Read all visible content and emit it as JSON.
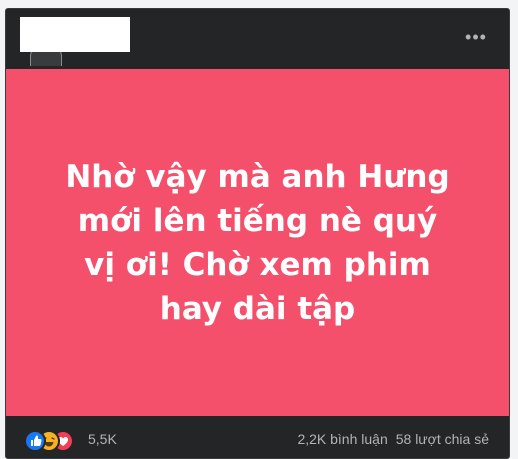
{
  "post": {
    "more_label": "•••",
    "status_text": "Nhờ vậy mà anh Hưng mới lên tiếng nè quý vị ơi! Chờ xem phim hay dài tập"
  },
  "footer": {
    "reaction_icons": [
      "like-icon",
      "haha-icon",
      "love-icon"
    ],
    "reaction_count": "5,5K",
    "comments": "2,2K bình luận",
    "shares": "58 lượt chia sẻ"
  },
  "colors": {
    "background": "#f3f4f6",
    "card": "#242526",
    "status_background": "#f4506b",
    "status_text": "#ffffff",
    "muted_text": "#b0b3b8",
    "like": "#1877f2",
    "haha": "#f7b125",
    "love": "#f33e58"
  }
}
